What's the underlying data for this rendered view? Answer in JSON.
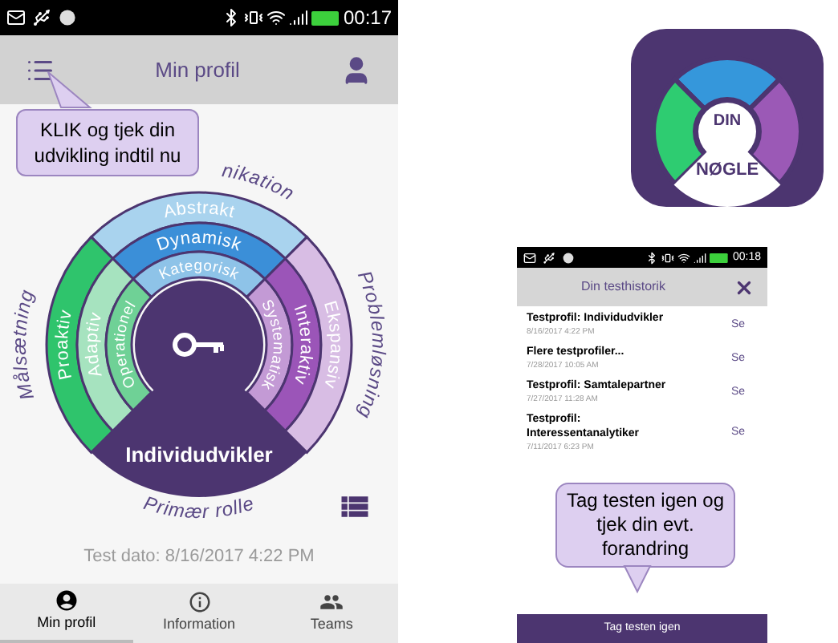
{
  "profile_screen": {
    "status_bar": {
      "time": "00:17"
    },
    "header": {
      "title": "Min profil"
    },
    "callout": "KLIK og tjek din udvikling indtil nu",
    "wheel": {
      "quadrants": [
        {
          "kind": "top",
          "rings": [
            {
              "kind": "outer",
              "label": "Abstrakt",
              "color": "#a9d3ee"
            },
            {
              "kind": "middle",
              "label": "Dynamisk",
              "color": "#3b8fd8"
            },
            {
              "kind": "inner",
              "label": "Kategorisk",
              "color": "#8ec3e8"
            }
          ]
        },
        {
          "kind": "left",
          "rings": [
            {
              "kind": "outer",
              "label": "Proaktiv",
              "color": "#2fc46c"
            },
            {
              "kind": "middle",
              "label": "Adaptiv",
              "color": "#a6e3bf"
            },
            {
              "kind": "inner",
              "label": "Operationel",
              "color": "#6fd196"
            }
          ]
        },
        {
          "kind": "right",
          "rings": [
            {
              "kind": "inner",
              "label": "Systematisk",
              "color": "#c39ad5"
            },
            {
              "kind": "middle",
              "label": "Interaktiv",
              "color": "#9b55b8"
            },
            {
              "kind": "outer",
              "label": "Ekspansiv",
              "color": "#d8bde4"
            }
          ]
        }
      ],
      "outer_labels": [
        {
          "kind": "top",
          "text": "nikation"
        },
        {
          "kind": "left",
          "text": "Målsætning"
        },
        {
          "kind": "right",
          "text": "Problemløsning"
        },
        {
          "kind": "bottom",
          "text": "Primær rolle"
        }
      ],
      "center_label": "Individudvikler"
    },
    "test_date": "Test dato: 8/16/2017 4:22 PM",
    "bottom_nav": [
      {
        "kind": "profile",
        "label": "Min profil",
        "selected": true
      },
      {
        "kind": "info",
        "label": "Information",
        "selected": false
      },
      {
        "kind": "teams",
        "label": "Teams",
        "selected": false
      }
    ]
  },
  "app_icon": {
    "line_1": "DIN",
    "line_2": "NØGLE"
  },
  "history_screen": {
    "status_bar": {
      "time": "00:18"
    },
    "header": {
      "title": "Din testhistorik"
    },
    "items": [
      {
        "title": "Testprofil: Individudvikler",
        "date": "8/16/2017 4:22 PM",
        "action": "Se"
      },
      {
        "title": "Flere testprofiler...",
        "date": "7/28/2017 10:05 AM",
        "action": "Se"
      },
      {
        "title": "Testprofil: Samtalepartner",
        "date": "7/27/2017 11:28 AM",
        "action": "Se"
      },
      {
        "title": "Testprofil: Interessentanalytiker",
        "date": "7/11/2017 6:23 PM",
        "action": "Se"
      }
    ],
    "callout": "Tag testen igen og tjek din evt. forandring",
    "button": "Tag testen igen"
  }
}
